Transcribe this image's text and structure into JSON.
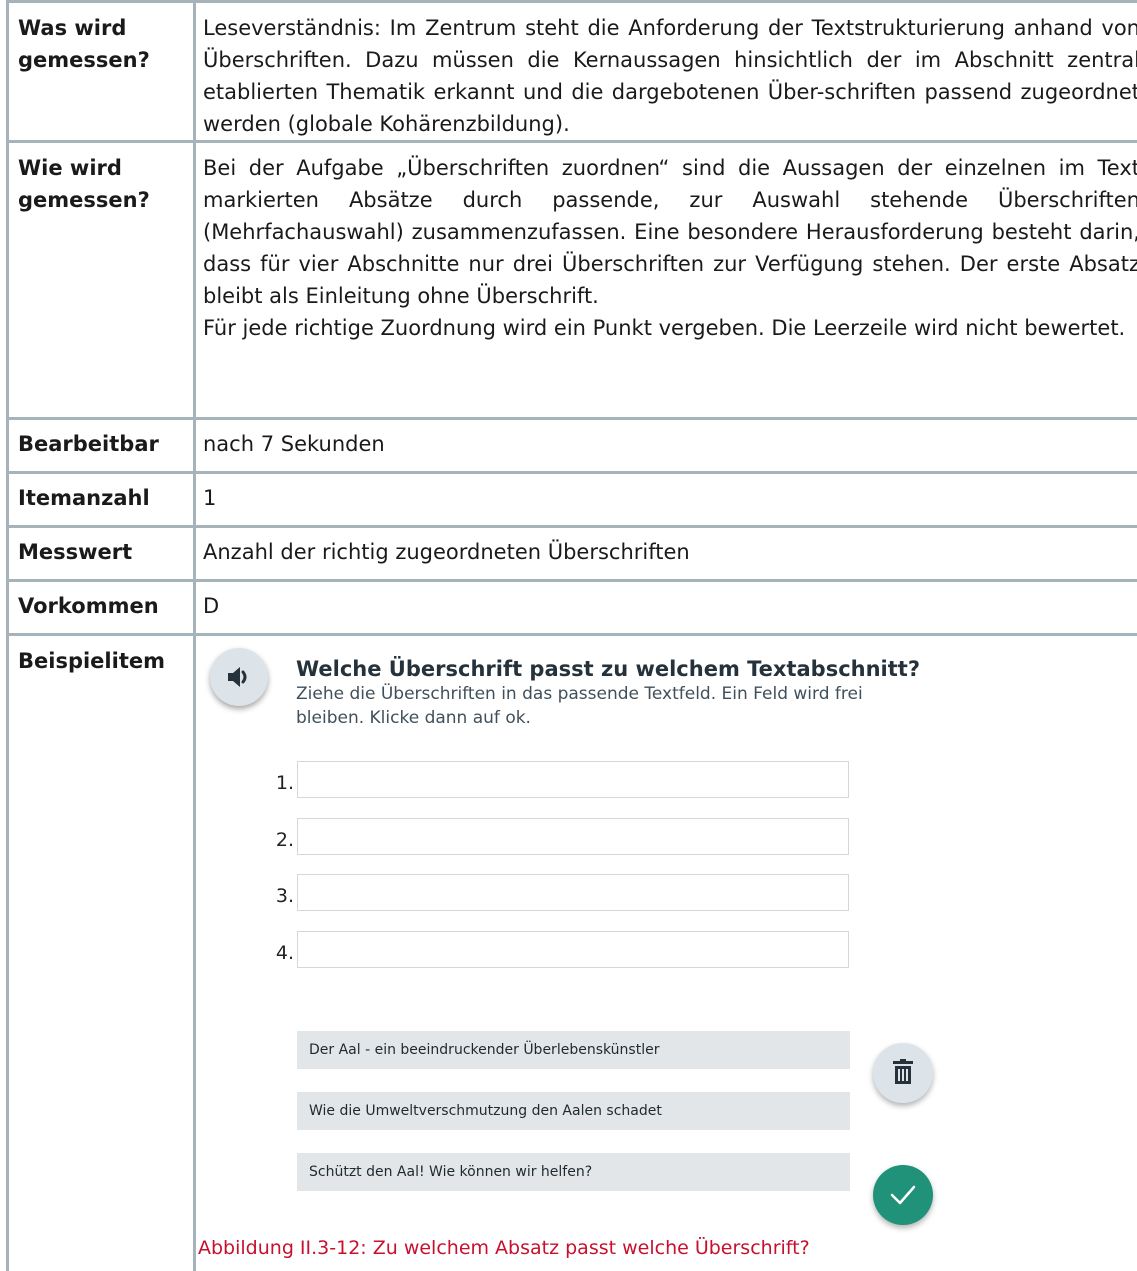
{
  "rows": [
    {
      "label": "Was wird gemessen?",
      "value": "Leseverständnis: Im Zentrum steht die Anforderung der Textstrukturierung anhand von Überschriften. Dazu müssen die Kernaussagen hinsichtlich der im Abschnitt zentral etablierten Thematik erkannt und die dargebotenen Über-schriften passend zugeordnet werden (globale Kohärenzbildung)."
    },
    {
      "label": "Wie wird gemessen?",
      "value": "Bei der Aufgabe „Überschriften zuordnen“ sind die Aussagen der einzelnen im Text markierten Absätze durch passende, zur Auswahl stehende Überschriften (Mehrfachauswahl) zusammenzufassen. Eine besondere Herausforderung besteht darin, dass für vier Abschnitte nur drei Überschriften zur Verfügung stehen. Der erste Absatz bleibt als Einleitung ohne Überschrift.",
      "value2": "Für jede richtige Zuordnung wird ein Punkt vergeben. Die Leerzeile wird nicht bewertet."
    },
    {
      "label": "Bearbeitbar",
      "value": "nach 7 Sekunden"
    },
    {
      "label": "Itemanzahl",
      "value": "1"
    },
    {
      "label": "Messwert",
      "value": "Anzahl der richtig zugeordneten Überschriften"
    },
    {
      "label": "Vorkommen",
      "value": "D"
    },
    {
      "label": "Beispielitem"
    }
  ],
  "example": {
    "icons": {
      "speaker": "speaker-icon",
      "trash": "trash-icon",
      "ok": "check-icon"
    },
    "question": "Welche Überschrift passt zu welchem Textabschnitt?",
    "instruction": "Ziehe die Überschriften in das passende Textfeld. Ein Feld wird frei bleiben. Klicke dann auf ok.",
    "slots": [
      "1.",
      "2.",
      "3.",
      "4."
    ],
    "headings": [
      "Der Aal - ein beeindruckender Überlebenskünstler",
      "Wie die Umweltverschmutzung den Aalen schadet",
      "Schützt den Aal! Wie können wir helfen?"
    ],
    "caption": "Abbildung II.3-12: Zu welchem Absatz passt welche Überschrift?",
    "colors": {
      "border": "#a7b3ba",
      "caption": "#c8102e",
      "ok_button": "#1f9279",
      "chip": "#e2e6e8"
    }
  }
}
